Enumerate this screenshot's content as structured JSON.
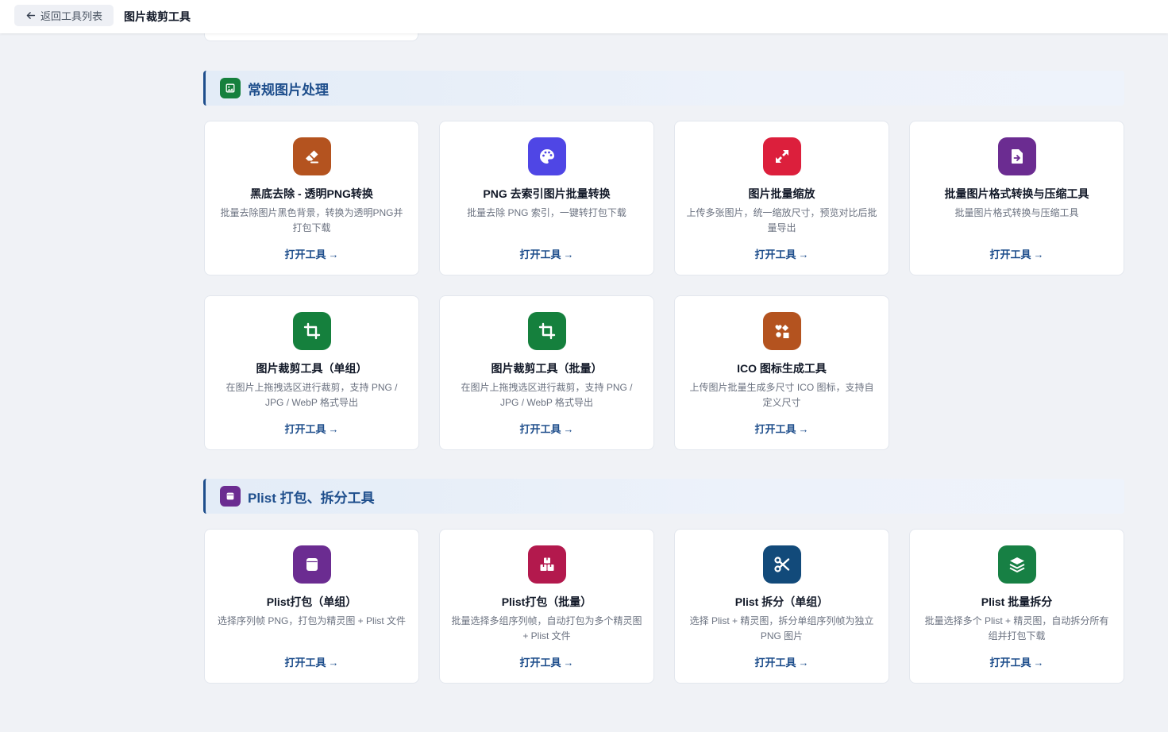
{
  "topbar": {
    "back_label": "返回工具列表",
    "page_title": "图片裁剪工具"
  },
  "sections": [
    {
      "title": "常规图片处理",
      "icon": "image-icon",
      "icon_color": "#15803d",
      "cards": [
        {
          "title": "黑底去除 - 透明PNG转换",
          "desc": "批量去除图片黑色背景，转换为透明PNG并打包下载",
          "icon": "eraser-icon",
          "color": "#b4531f",
          "link": "打开工具"
        },
        {
          "title": "PNG 去索引图片批量转换",
          "desc": "批量去除 PNG 索引，一键转打包下载",
          "icon": "palette-icon",
          "color": "#4f46e5",
          "link": "打开工具"
        },
        {
          "title": "图片批量缩放",
          "desc": "上传多张图片，统一缩放尺寸，预览对比后批量导出",
          "icon": "expand-icon",
          "color": "#dc1f3c",
          "link": "打开工具"
        },
        {
          "title": "批量图片格式转换与压缩工具",
          "desc": "批量图片格式转换与压缩工具",
          "icon": "file-import-icon",
          "color": "#6b2c91",
          "link": "打开工具"
        },
        {
          "title": "图片裁剪工具（单组）",
          "desc": "在图片上拖拽选区进行裁剪，支持 PNG / JPG / WebP 格式导出",
          "icon": "crop-icon",
          "color": "#15803d",
          "link": "打开工具"
        },
        {
          "title": "图片裁剪工具（批量）",
          "desc": "在图片上拖拽选区进行裁剪，支持 PNG / JPG / WebP 格式导出",
          "icon": "crop-icon",
          "color": "#15803d",
          "link": "打开工具"
        },
        {
          "title": "ICO 图标生成工具",
          "desc": "上传图片批量生成多尺寸 ICO 图标，支持自定义尺寸",
          "icon": "icons-icon",
          "color": "#b4531f",
          "link": "打开工具"
        }
      ]
    },
    {
      "title": "Plist 打包、拆分工具",
      "icon": "box-icon",
      "icon_color": "#6b2c91",
      "cards": [
        {
          "title": "Plist打包（单组）",
          "desc": "选择序列帧 PNG，打包为精灵图 + Plist 文件",
          "icon": "box-icon",
          "color": "#6b2c91",
          "link": "打开工具"
        },
        {
          "title": "Plist打包（批量）",
          "desc": "批量选择多组序列帧，自动打包为多个精灵图 + Plist 文件",
          "icon": "boxes-icon",
          "color": "#b3194d",
          "link": "打开工具"
        },
        {
          "title": "Plist 拆分（单组）",
          "desc": "选择 Plist + 精灵图，拆分单组序列帧为独立 PNG 图片",
          "icon": "scissors-icon",
          "color": "#124a7a",
          "link": "打开工具"
        },
        {
          "title": "Plist 批量拆分",
          "desc": "批量选择多个 Plist + 精灵图，自动拆分所有组并打包下载",
          "icon": "layers-icon",
          "color": "#178044",
          "link": "打开工具"
        }
      ]
    }
  ]
}
